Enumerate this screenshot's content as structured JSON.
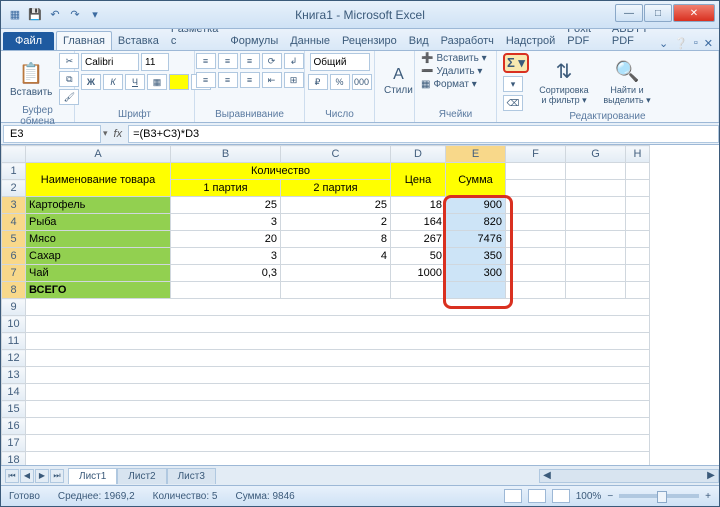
{
  "title": "Книга1 - Microsoft Excel",
  "tabs": {
    "file": "Файл",
    "home": "Главная",
    "insert": "Вставка",
    "layout": "Разметка с",
    "formulas": "Формулы",
    "data": "Данные",
    "review": "Рецензиро",
    "view": "Вид",
    "dev": "Разработч",
    "addins": "Надстрой",
    "foxit": "Foxit PDF",
    "abbyy": "ABBYY PDF"
  },
  "ribbon": {
    "clipboard": {
      "paste": "Вставить",
      "label": "Буфер обмена"
    },
    "font": {
      "name": "Calibri",
      "size": "11",
      "label": "Шрифт"
    },
    "align": {
      "label": "Выравнивание"
    },
    "number": {
      "format": "Общий",
      "label": "Число"
    },
    "styles": {
      "btn": "Стили"
    },
    "cells": {
      "insert": "Вставить ▾",
      "delete": "Удалить ▾",
      "format": "Формат ▾",
      "label": "Ячейки"
    },
    "edit": {
      "sort": "Сортировка и фильтр ▾",
      "find": "Найти и выделить ▾",
      "label": "Редактирование"
    }
  },
  "namebox": "E3",
  "formula": "=(B3+C3)*D3",
  "cols": [
    "A",
    "B",
    "C",
    "D",
    "E",
    "F",
    "G",
    "H"
  ],
  "table": {
    "h_quantity": "Количество",
    "h_name": "Наименование товара",
    "h_p1": "1 партия",
    "h_p2": "2 партия",
    "h_price": "Цена",
    "h_sum": "Сумма",
    "rows": [
      {
        "n": "Картофель",
        "b": "25",
        "c": "25",
        "d": "18",
        "e": "900"
      },
      {
        "n": "Рыба",
        "b": "3",
        "c": "2",
        "d": "164",
        "e": "820"
      },
      {
        "n": "Мясо",
        "b": "20",
        "c": "8",
        "d": "267",
        "e": "7476"
      },
      {
        "n": "Сахар",
        "b": "3",
        "c": "4",
        "d": "50",
        "e": "350"
      },
      {
        "n": "Чай",
        "b": "0,3",
        "c": "",
        "d": "1000",
        "e": "300"
      }
    ],
    "total": "ВСЕГО"
  },
  "sheets": {
    "s1": "Лист1",
    "s2": "Лист2",
    "s3": "Лист3"
  },
  "status": {
    "ready": "Готово",
    "avg": "Среднее: 1969,2",
    "count": "Количество: 5",
    "sum": "Сумма: 9846",
    "zoom": "100%"
  },
  "chart_data": {
    "type": "table",
    "columns": [
      "Наименование товара",
      "1 партия",
      "2 партия",
      "Цена",
      "Сумма"
    ],
    "rows": [
      [
        "Картофель",
        25,
        25,
        18,
        900
      ],
      [
        "Рыба",
        3,
        2,
        164,
        820
      ],
      [
        "Мясо",
        20,
        8,
        267,
        7476
      ],
      [
        "Сахар",
        3,
        4,
        50,
        350
      ],
      [
        "Чай",
        0.3,
        null,
        1000,
        300
      ]
    ]
  }
}
